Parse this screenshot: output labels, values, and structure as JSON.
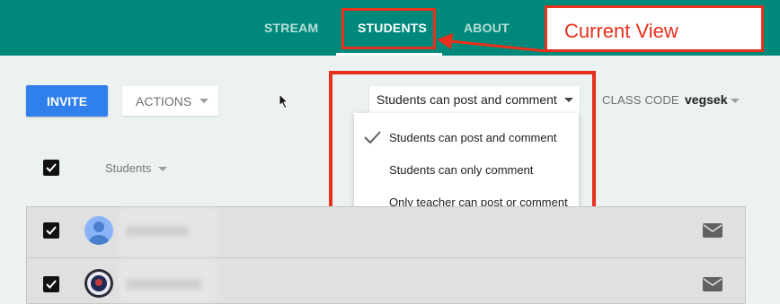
{
  "header": {
    "tabs": [
      {
        "label": "STREAM",
        "active": false
      },
      {
        "label": "STUDENTS",
        "active": true
      },
      {
        "label": "ABOUT",
        "active": false
      }
    ],
    "callout": "Current View"
  },
  "toolbar": {
    "invite_label": "INVITE",
    "actions_label": "ACTIONS",
    "permission_selected": "Students can post and comment",
    "permission_options": [
      "Students can post and comment",
      "Students can only comment",
      "Only teacher can post or comment"
    ],
    "class_code_label": "CLASS CODE",
    "class_code_value": "vegsek"
  },
  "list": {
    "header_label": "Students",
    "rows": [
      {
        "avatar": "default-avatar-icon",
        "name_redacted": true
      },
      {
        "avatar": "photo-avatar",
        "name_redacted": true
      }
    ]
  },
  "colors": {
    "header": "#00897b",
    "accent": "#2f80ed",
    "annotation": "#e8301a",
    "background": "#ebf2f0"
  }
}
